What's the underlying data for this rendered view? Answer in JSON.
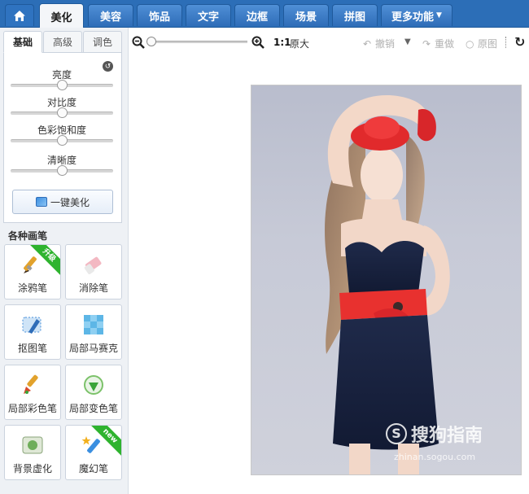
{
  "nav": {
    "home_icon": "home-icon",
    "tabs": [
      {
        "label": "美化",
        "active": true
      },
      {
        "label": "美容",
        "active": false
      },
      {
        "label": "饰品",
        "active": false
      },
      {
        "label": "文字",
        "active": false
      },
      {
        "label": "边框",
        "active": false
      },
      {
        "label": "场景",
        "active": false
      },
      {
        "label": "拼图",
        "active": false
      },
      {
        "label": "更多功能",
        "active": false,
        "dropdown": true
      }
    ]
  },
  "left_panel": {
    "subtabs": [
      "基础",
      "高级",
      "调色"
    ],
    "active_subtab": "基础",
    "sliders": [
      {
        "label": "亮度",
        "value": 0.5
      },
      {
        "label": "对比度",
        "value": 0.5
      },
      {
        "label": "色彩饱和度",
        "value": 0.5
      },
      {
        "label": "清晰度",
        "value": 0.5
      }
    ],
    "auto_button": "一键美化",
    "brush_section_title": "各种画笔",
    "brushes": [
      {
        "label": "涂鸦笔",
        "icon": "paintbrush-icon",
        "badge": "升级"
      },
      {
        "label": "消除笔",
        "icon": "eraser-icon",
        "badge": ""
      },
      {
        "label": "抠图笔",
        "icon": "cutout-pen-icon",
        "badge": ""
      },
      {
        "label": "局部马赛克",
        "icon": "mosaic-icon",
        "badge": ""
      },
      {
        "label": "局部彩色笔",
        "icon": "color-brush-icon",
        "badge": ""
      },
      {
        "label": "局部变色笔",
        "icon": "recolor-icon",
        "badge": ""
      },
      {
        "label": "背景虚化",
        "icon": "blur-background-icon",
        "badge": ""
      },
      {
        "label": "魔幻笔",
        "icon": "magic-pen-icon",
        "badge": "new"
      }
    ]
  },
  "toolbar": {
    "zoom_level": 0.0,
    "ratio_label": "1:1",
    "original_size": "原大",
    "undo": "撤销",
    "redo": "重做",
    "original_image": "原图"
  },
  "canvas": {
    "watermark_main": "搜狗指南",
    "watermark_url": "zhinan.sogou.com"
  },
  "colors": {
    "nav_blue": "#2c6eb7",
    "accent_red": "#e8312f",
    "badge_green": "#2eb32e"
  }
}
